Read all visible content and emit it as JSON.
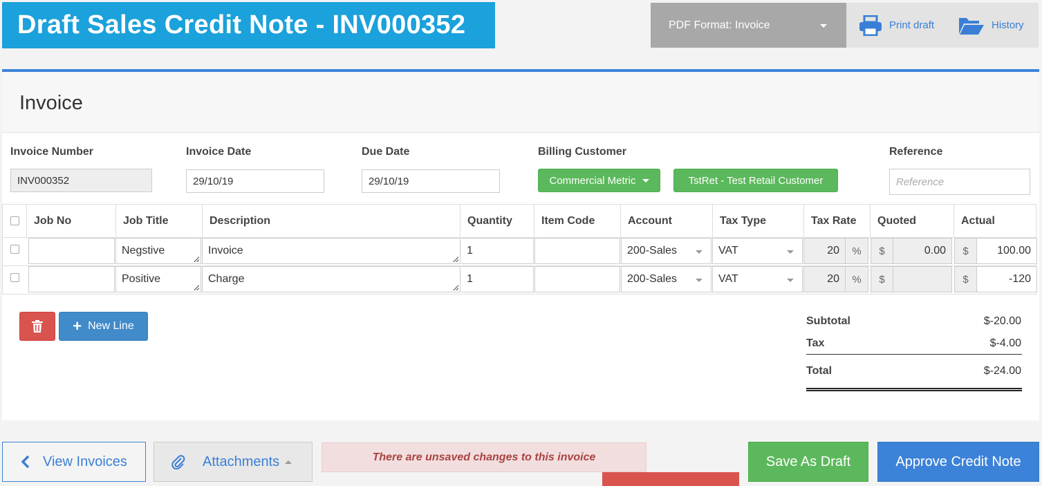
{
  "header": {
    "title": "Draft Sales Credit Note - INV000352",
    "pdf_format": "PDF Format: Invoice",
    "print_draft": "Print draft",
    "history": "History"
  },
  "card": {
    "title": "Invoice"
  },
  "fields": {
    "invoice_number": {
      "label": "Invoice Number",
      "value": "INV000352"
    },
    "invoice_date": {
      "label": "Invoice Date",
      "value": "29/10/19"
    },
    "due_date": {
      "label": "Due Date",
      "value": "29/10/19"
    },
    "billing_customer": {
      "label": "Billing Customer",
      "metric": "Commercial Metric",
      "customer": "TstRet - Test Retail Customer"
    },
    "reference": {
      "label": "Reference",
      "placeholder": "Reference"
    }
  },
  "table": {
    "columns": [
      "Job No",
      "Job Title",
      "Description",
      "Quantity",
      "Item Code",
      "Account",
      "Tax Type",
      "Tax Rate",
      "Quoted",
      "Actual"
    ],
    "rows": [
      {
        "job_no": "",
        "job_title": "Negstive",
        "description": "Invoice",
        "quantity": "1",
        "item_code": "",
        "account": "200-Sales",
        "tax_type": "VAT",
        "tax_rate": "20",
        "quoted": "0.00",
        "actual": "100.00"
      },
      {
        "job_no": "",
        "job_title": "Positive",
        "description": "Charge",
        "quantity": "1",
        "item_code": "",
        "account": "200-Sales",
        "tax_type": "VAT",
        "tax_rate": "20",
        "quoted": "",
        "actual": "-120"
      }
    ],
    "percent_symbol": "%",
    "currency_symbol": "$"
  },
  "actions": {
    "new_line": "New Line"
  },
  "totals": {
    "subtotal_label": "Subtotal",
    "subtotal": "$-20.00",
    "tax_label": "Tax",
    "tax": "$-4.00",
    "total_label": "Total",
    "total": "$-24.00"
  },
  "footer": {
    "view_invoices": "View Invoices",
    "attachments": "Attachments",
    "alert": "There are unsaved changes to this invoice",
    "save_draft": "Save As Draft",
    "approve": "Approve Credit Note"
  },
  "colors": {
    "banner": "#1ba1db",
    "primary": "#3c82d8",
    "success": "#5cb85c",
    "danger": "#d9534f"
  }
}
